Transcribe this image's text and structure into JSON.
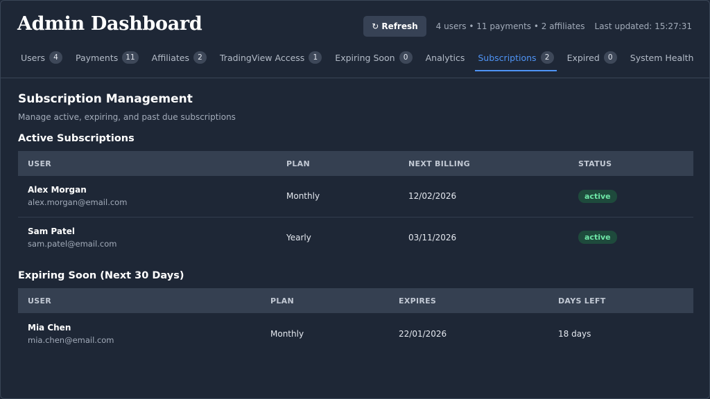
{
  "header": {
    "title": "Admin Dashboard",
    "refresh_icon": "↻",
    "refresh_label": "Refresh",
    "summary": "4 users • 11 payments • 2 affiliates",
    "last_updated": "Last updated: 15:27:31"
  },
  "tabs": [
    {
      "label": "Users",
      "count": "4"
    },
    {
      "label": "Payments",
      "count": "11"
    },
    {
      "label": "Affiliates",
      "count": "2"
    },
    {
      "label": "TradingView Access",
      "count": "1"
    },
    {
      "label": "Expiring Soon",
      "count": "0"
    },
    {
      "label": "Analytics",
      "count": ""
    },
    {
      "label": "Subscriptions",
      "count": "2"
    },
    {
      "label": "Expired",
      "count": "0"
    },
    {
      "label": "System Health",
      "count": ""
    }
  ],
  "active_tab": "Subscriptions",
  "main": {
    "title": "Subscription Management",
    "description": "Manage active, expiring, and past due subscriptions"
  },
  "active_subscriptions": {
    "title": "Active Subscriptions",
    "columns": [
      "USER",
      "PLAN",
      "NEXT BILLING",
      "STATUS"
    ],
    "rows": [
      {
        "name": "Alex Morgan",
        "email": "alex.morgan@email.com",
        "plan": "Monthly",
        "next_billing": "12/02/2026",
        "status": "active"
      },
      {
        "name": "Sam Patel",
        "email": "sam.patel@email.com",
        "plan": "Yearly",
        "next_billing": "03/11/2026",
        "status": "active"
      }
    ]
  },
  "expiring_soon": {
    "title": "Expiring Soon (Next 30 Days)",
    "columns": [
      "USER",
      "PLAN",
      "EXPIRES",
      "DAYS LEFT"
    ],
    "rows": [
      {
        "name": "Mia Chen",
        "email": "mia.chen@email.com",
        "plan": "Monthly",
        "expires": "22/01/2026",
        "days_left": "18 days"
      }
    ]
  },
  "colors": {
    "background": "#1e2736",
    "accent": "#4f94f6",
    "status_active_bg": "#1e4a3c",
    "status_active_text": "#6ee7a7"
  }
}
